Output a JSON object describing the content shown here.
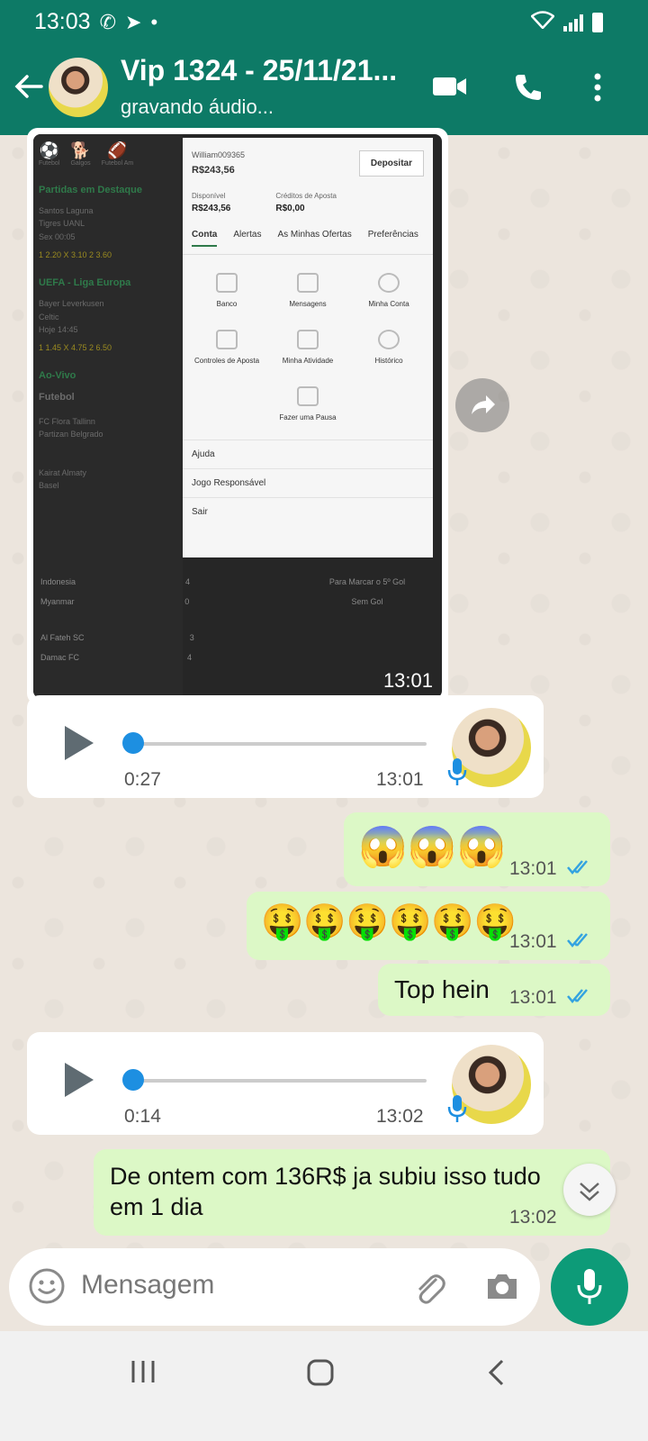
{
  "status_bar": {
    "time": "13:03"
  },
  "header": {
    "title": "Vip 1324 - 25/11/21...",
    "subtitle": "gravando áudio..."
  },
  "image_message": {
    "time": "13:01",
    "screenshot": {
      "sports": [
        "Futebol",
        "Galgos",
        "Futebol Am"
      ],
      "section1": "Partidas em Destaque",
      "match1": [
        "Santos Laguna",
        "Tigres UANL",
        "Sex 00:05"
      ],
      "odds1": "1 2.20   X 3.10   2 3.60",
      "section2": "UEFA - Liga Europa",
      "match2": [
        "Bayer Leverkusen",
        "Celtic",
        "Hoje 14:45"
      ],
      "odds2": "1 1.45   X 4.75   2 6.50",
      "live": "Ao-Vivo",
      "live_sport": "Futebol",
      "live1": [
        "FC Flora Tallinn",
        "Partizan Belgrado"
      ],
      "live2": [
        "Kairat Almaty",
        "Basel"
      ],
      "live3": [
        "Indonesia",
        "Myanmar"
      ],
      "live3_scores": [
        "4",
        "0"
      ],
      "live4": [
        "Al Fateh SC",
        "Damac FC"
      ],
      "live4_scores": [
        "3",
        "4"
      ],
      "bottom_labels": [
        "Para Marcar o 5º Gol",
        "Sem Gol"
      ],
      "menu": {
        "username": "William009365",
        "balance": "R$243,56",
        "deposit": "Depositar",
        "available_label": "Disponível",
        "available_value": "R$243,56",
        "credits_label": "Créditos de Aposta",
        "credits_value": "R$0,00",
        "tabs": [
          "Conta",
          "Alertas",
          "As Minhas Ofertas",
          "Preferências"
        ],
        "grid": [
          "Banco",
          "Mensagens",
          "Minha Conta",
          "Controles de Aposta",
          "Minha Atividade",
          "Histórico",
          "Fazer uma Pausa"
        ],
        "links": [
          "Ajuda",
          "Jogo Responsável",
          "Sair"
        ]
      }
    }
  },
  "voice1": {
    "duration": "0:27",
    "time": "13:01"
  },
  "voice2": {
    "duration": "0:14",
    "time": "13:02"
  },
  "out1": {
    "emojis": "😱😱😱",
    "time": "13:01"
  },
  "out2": {
    "emojis": "🤑🤑🤑🤑🤑🤑",
    "time": "13:01"
  },
  "out3": {
    "text": "Top hein",
    "time": "13:01"
  },
  "out4": {
    "text_line1": "De ontem com 136R$ ja subiu isso tudo",
    "text_line2": "em 1 dia",
    "time": "13:02"
  },
  "input": {
    "placeholder": "Mensagem"
  },
  "colors": {
    "header": "#0d7a66",
    "outgoing": "#dcf8c6",
    "accent": "#0d9b78",
    "tick": "#34a3e0"
  }
}
